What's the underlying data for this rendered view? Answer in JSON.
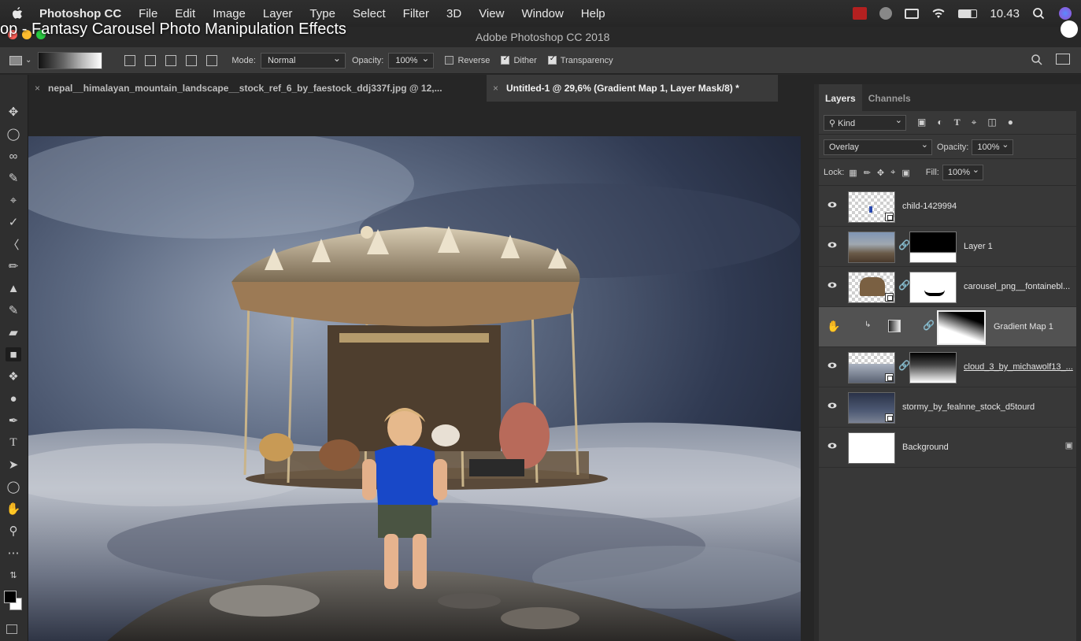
{
  "menubar": {
    "app_name": "Photoshop CC",
    "items": [
      "File",
      "Edit",
      "Image",
      "Layer",
      "Type",
      "Select",
      "Filter",
      "3D",
      "View",
      "Window",
      "Help"
    ],
    "clock": "10.43"
  },
  "video_title": "op - Fantasy Carousel Photo Manipulation Effects",
  "window_title": "Adobe Photoshop CC 2018",
  "options_bar": {
    "mode_label": "Mode:",
    "mode_value": "Normal",
    "opacity_label": "Opacity:",
    "opacity_value": "100%",
    "reverse_label": "Reverse",
    "reverse_checked": false,
    "dither_label": "Dither",
    "dither_checked": true,
    "transparency_label": "Transparency",
    "transparency_checked": true
  },
  "tabs": [
    {
      "close": "×",
      "label": "nepal__himalayan_mountain_landscape__stock_ref_6_by_faestock_ddj337f.jpg @ 12,...",
      "active": false
    },
    {
      "close": "×",
      "label": "Untitled-1 @ 29,6% (Gradient Map 1, Layer Mask/8) *",
      "active": true
    }
  ],
  "panel": {
    "tabs": [
      "Layers",
      "Channels"
    ],
    "active_tab": "Layers",
    "filter_kind": "Kind",
    "blend_mode": "Overlay",
    "opacity_label": "Opacity:",
    "opacity_value": "100%",
    "lock_label": "Lock:",
    "fill_label": "Fill:",
    "fill_value": "100%"
  },
  "layers": [
    {
      "name": "child-1429994",
      "has_mask": false,
      "visible": true,
      "selected": false
    },
    {
      "name": "Layer 1",
      "has_mask": true,
      "visible": true,
      "selected": false
    },
    {
      "name": "carousel_png__fontainebl...",
      "has_mask": true,
      "visible": true,
      "selected": false
    },
    {
      "name": "Gradient Map 1",
      "has_mask": true,
      "visible": true,
      "selected": true
    },
    {
      "name": "cloud_3_by_michawolf13_...",
      "has_mask": true,
      "visible": true,
      "selected": false
    },
    {
      "name": "stormy_by_fealnne_stock_d5tourd",
      "has_mask": false,
      "visible": true,
      "selected": false
    },
    {
      "name": "Background",
      "has_mask": false,
      "visible": true,
      "selected": false,
      "locked": true
    }
  ],
  "colors": {
    "ui_dark": "#2b2b2b",
    "panel": "#383838",
    "selected_layer": "#525252"
  }
}
